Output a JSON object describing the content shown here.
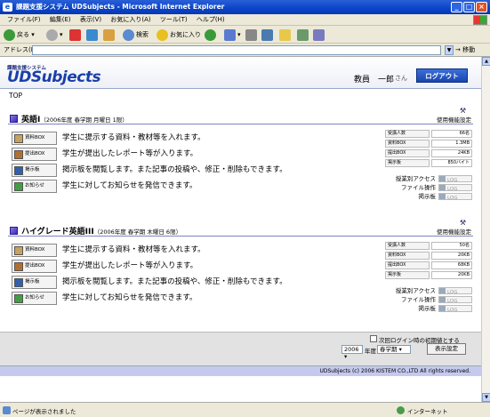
{
  "window": {
    "title": "課題支援システム UDSubjects - Microsoft Internet Explorer"
  },
  "menu": [
    "ファイル(F)",
    "編集(E)",
    "表示(V)",
    "お気に入り(A)",
    "ツール(T)",
    "ヘルプ(H)"
  ],
  "toolbar": {
    "back": "戻る",
    "search": "検索",
    "favorites": "お気に入り"
  },
  "address": {
    "label": "アドレス(D)",
    "value": "",
    "go": "移動"
  },
  "header": {
    "logo_sub": "課題支援システム",
    "logo": "UDSubjects",
    "user": "教員　一郎",
    "honorific": "さん",
    "logout": "ログアウト"
  },
  "breadcrumb": "TOP",
  "courses": [
    {
      "name": "英語I",
      "meta": "（2006年度 春学期 月曜日 1限）",
      "settings": "使用機能設定",
      "features": [
        {
          "button": "資料BOX",
          "text": "学生に提示する資料・教材等を入れます。",
          "color": "#c8a060"
        },
        {
          "button": "提出BOX",
          "text": "学生が提出したレポート等が入ります。",
          "color": "#b07030"
        },
        {
          "button": "掲示板",
          "text": "掲示板を閲覧します。また記事の投稿や、修正・削除もできます。",
          "color": "#3060b0"
        },
        {
          "button": "お知らせ",
          "text": "学生に対してお知らせを発信できます。",
          "color": "#40a040"
        }
      ],
      "stats": [
        {
          "key": "受講人数",
          "value": "66名"
        },
        {
          "key": "資料BOX",
          "value": "1.3MB"
        },
        {
          "key": "提出BOX",
          "value": "24KB"
        },
        {
          "key": "掲示板",
          "value": "850バイト"
        }
      ],
      "logs": [
        {
          "key": "授業別アクセス",
          "button": "LOG"
        },
        {
          "key": "ファイル操作",
          "button": "LOG"
        },
        {
          "key": "掲示板",
          "button": "LOG"
        }
      ]
    },
    {
      "name": "ハイグレード英語III",
      "meta": "（2006年度 春学期 木曜日 6限）",
      "settings": "使用機能設定",
      "features": [
        {
          "button": "資料BOX",
          "text": "学生に提示する資料・教材等を入れます。",
          "color": "#c8a060"
        },
        {
          "button": "提出BOX",
          "text": "学生が提出したレポート等が入ります。",
          "color": "#b07030"
        },
        {
          "button": "掲示板",
          "text": "掲示板を閲覧します。また記事の投稿や、修正・削除もできます。",
          "color": "#3060b0"
        },
        {
          "button": "お知らせ",
          "text": "学生に対してお知らせを発信できます。",
          "color": "#40a040"
        }
      ],
      "stats": [
        {
          "key": "受講人数",
          "value": "50名"
        },
        {
          "key": "資料BOX",
          "value": "20KB"
        },
        {
          "key": "提出BOX",
          "value": "68KB"
        },
        {
          "key": "掲示板",
          "value": "20KB"
        }
      ],
      "logs": [
        {
          "key": "授業別アクセス",
          "button": "LOG"
        },
        {
          "key": "ファイル操作",
          "button": "LOG"
        },
        {
          "key": "掲示板",
          "button": "LOG"
        }
      ]
    }
  ],
  "bottom": {
    "checkbox_label": "次回ログイン時の初期値とする",
    "year": "2006",
    "year_unit": "年度",
    "term": "春学期",
    "display_button": "表示設定"
  },
  "footer": "UDSubjects (c) 2006 KISTEM CO.,LTD All rights reserved.",
  "status": {
    "text": "ページが表示されました",
    "zone": "インターネット"
  }
}
